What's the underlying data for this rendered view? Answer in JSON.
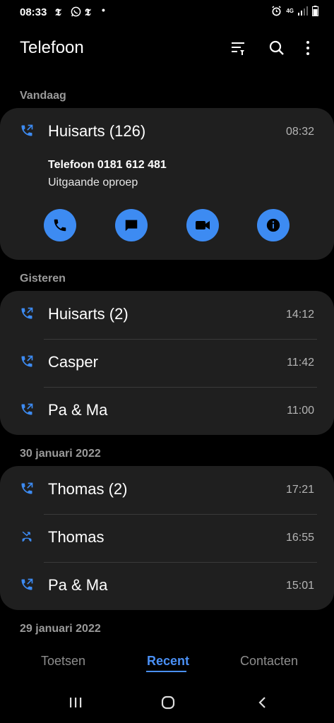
{
  "status": {
    "time": "08:33",
    "network": "4G"
  },
  "app": {
    "title": "Telefoon"
  },
  "sections": [
    {
      "label": "Vandaag",
      "rows": [
        {
          "name": "Huisarts (126)",
          "time": "08:32",
          "type": "outgoing"
        }
      ],
      "detail": {
        "line1": "Telefoon 0181 612 481",
        "line2": "Uitgaande oproep"
      }
    },
    {
      "label": "Gisteren",
      "rows": [
        {
          "name": "Huisarts (2)",
          "time": "14:12",
          "type": "outgoing"
        },
        {
          "name": "Casper",
          "time": "11:42",
          "type": "outgoing"
        },
        {
          "name": "Pa & Ma",
          "time": "11:00",
          "type": "outgoing"
        }
      ]
    },
    {
      "label": "30 januari 2022",
      "rows": [
        {
          "name": "Thomas (2)",
          "time": "17:21",
          "type": "outgoing"
        },
        {
          "name": "Thomas",
          "time": "16:55",
          "type": "missed"
        },
        {
          "name": "Pa & Ma",
          "time": "15:01",
          "type": "outgoing"
        }
      ]
    },
    {
      "label": "29 januari 2022"
    }
  ],
  "tabs": {
    "keypad": "Toetsen",
    "recent": "Recent",
    "contacts": "Contacten"
  },
  "colors": {
    "accent": "#3d8bf2",
    "card": "#1f1f1f",
    "background": "#000000"
  }
}
